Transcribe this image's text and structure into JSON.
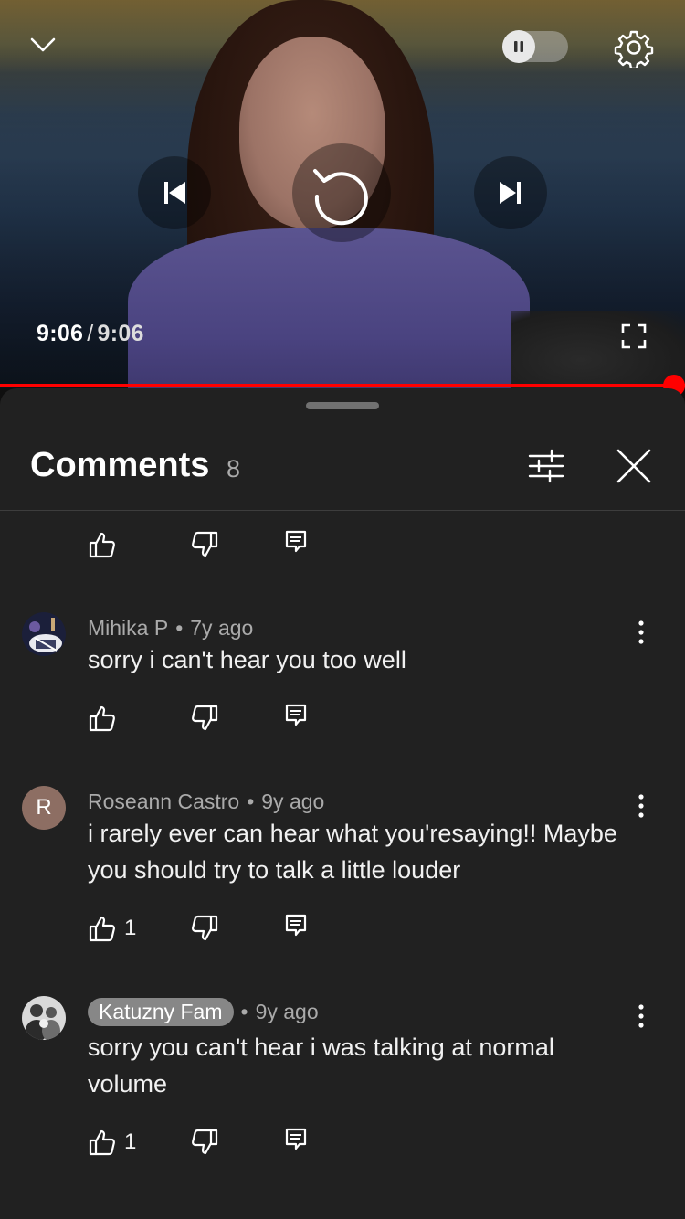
{
  "player": {
    "current_time": "9:06",
    "separator": "/",
    "duration": "9:06",
    "progress_fraction": 1.0,
    "autoplay_enabled": false
  },
  "comments_panel": {
    "title": "Comments",
    "count": "8",
    "icons": {
      "filter": "sliders-icon",
      "close": "close-icon"
    }
  },
  "comments": [
    {
      "author": "Mihika P",
      "time": "7y ago",
      "text": "sorry i can't hear you too well",
      "likes": "",
      "avatar_letter": "",
      "highlighted": false
    },
    {
      "author": "Roseann Castro",
      "time": "9y ago",
      "text": "i rarely ever can hear what you'resaying!! Maybe you should try to talk a little louder",
      "likes": "1",
      "avatar_letter": "R",
      "highlighted": false
    },
    {
      "author": "Katuzny Fam",
      "time": "9y ago",
      "text": "sorry you can't hear i was talking at normal volume",
      "likes": "1",
      "avatar_letter": "",
      "highlighted": true
    }
  ],
  "colors": {
    "accent": "#ff0000",
    "sheet_bg": "#212121",
    "secondary_text": "#aaaaaa",
    "avatar_r": "#8d6e63",
    "author_chip": "#878787"
  }
}
